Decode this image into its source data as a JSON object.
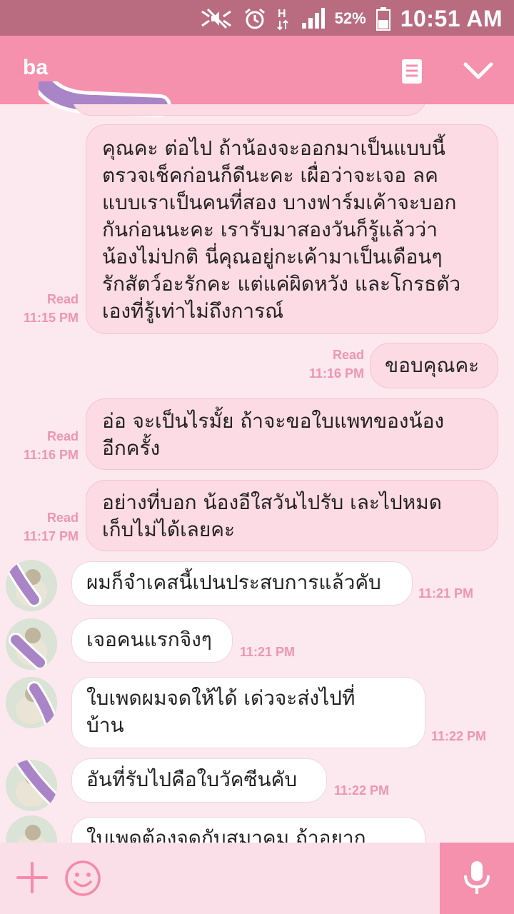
{
  "status_bar": {
    "battery": "52%",
    "time": "10:51 AM"
  },
  "header": {
    "title": "ba"
  },
  "messages": [
    {
      "text": "คุณคะ ต่อไป ถ้าน้องจะออกมาเป็นแบบนี้\nตรวจเช็คก่อนก็ดีนะคะ เผื่อว่าจะเจอ ลค\nแบบเราเป็นคนที่สอง บางฟาร์มเค้าจะบอก\nกันก่อนนะคะ เรารับมาสองวันก็รู้แล้วว่า\nน้องไม่ปกติ นี่คุณอยู่กะเค้ามาเป็นเดือนๆ\nรักสัตว์อะรักคะ แต่แค่ผิดหวัง และโกรธตัว\nเองที่รู้เท่าไม่ถึงการณ์",
      "read": "Read",
      "time": "11:15 PM"
    },
    {
      "text": "ขอบคุณคะ",
      "read": "Read",
      "time": "11:16 PM"
    },
    {
      "text": "อ่อ จะเป็นไรมั้ย ถ้าจะขอใบแพทของน้อง\nอีกครั้ง",
      "read": "Read",
      "time": "11:16 PM"
    },
    {
      "text": "อย่างที่บอก น้องอีใสวันไปรับ เละไปหมด\nเก็บไม่ได้เลยคะ",
      "read": "Read",
      "time": "11:17 PM"
    },
    {
      "text": "ผมก็จำเคสนี้เปนประสบการแล้วคับ",
      "time": "11:21 PM"
    },
    {
      "text": "เจอคนแรกจิงๆ",
      "time": "11:21 PM"
    },
    {
      "text": "ใบเพดผมจดให้ได้ เด่วจะส่งไปที่\nบ้าน",
      "time": "11:22 PM"
    },
    {
      "text": "อันที่รับไปคือใบวัคซีนคับ",
      "time": "11:22 PM"
    },
    {
      "text": "ใบเพดต้องจดกับสมาคม ถ้าอยาก"
    }
  ],
  "colors": {
    "accent": "#f590ad",
    "status_bar": "#b96b80",
    "background": "#fbe9ef",
    "meta_text": "#f095b1"
  },
  "icons": {
    "header": [
      "doc-icon",
      "chevron-down-icon"
    ],
    "input": [
      "plus-icon",
      "smile-icon",
      "mic-icon"
    ]
  }
}
